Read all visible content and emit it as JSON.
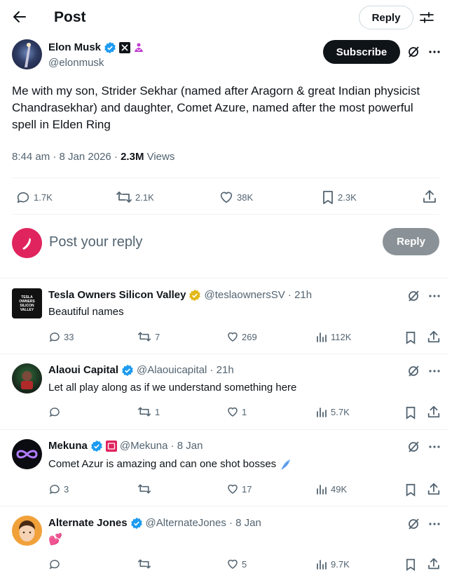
{
  "header": {
    "title": "Post",
    "reply_button": "Reply"
  },
  "post": {
    "author_name": "Elon Musk",
    "author_handle": "@elonmusk",
    "subscribe_label": "Subscribe",
    "text": "Me with my son, Strider Sekhar (named after Aragorn & great Indian physicist Chandrasekhar) and daughter, Comet Azure, named after the most powerful spell in Elden Ring",
    "time": "8:44 am · 8 Jan 2026 · ",
    "views_count": "2.3M",
    "views_label": " Views",
    "replies": "1.7K",
    "reposts": "2.1K",
    "likes": "38K",
    "bookmarks": "2.3K"
  },
  "composer": {
    "placeholder": "Post your reply",
    "reply_label": "Reply"
  },
  "replies": [
    {
      "name": "Tesla Owners Silicon Valley",
      "handle": "@teslaownersSV · 21h",
      "text": "Beautiful names",
      "replies": "33",
      "reposts": "7",
      "likes": "269",
      "views": "112K",
      "avatar_text": "TESLA OWNERS SILICON VALLEY"
    },
    {
      "name": "Alaoui Capital",
      "handle": "@Alaouicapital · 21h",
      "text": "Let all play along as if we understand something here",
      "replies": "",
      "reposts": "1",
      "likes": "1",
      "views": "5.7K"
    },
    {
      "name": "Mekuna",
      "handle": "@Mekuna · 8 Jan",
      "text": "Comet Azur is amazing and can one shot bosses",
      "replies": "3",
      "reposts": "",
      "likes": "17",
      "views": "49K"
    },
    {
      "name": "Alternate Jones",
      "handle": "@AlternateJones · 8 Jan",
      "text": "💕",
      "replies": "",
      "reposts": "",
      "likes": "5",
      "views": "9.7K"
    }
  ],
  "colors": {
    "verified_blue": "#1d9bf0",
    "verified_gold": "#e2b719",
    "text": "#0f1419",
    "muted": "#536471"
  }
}
